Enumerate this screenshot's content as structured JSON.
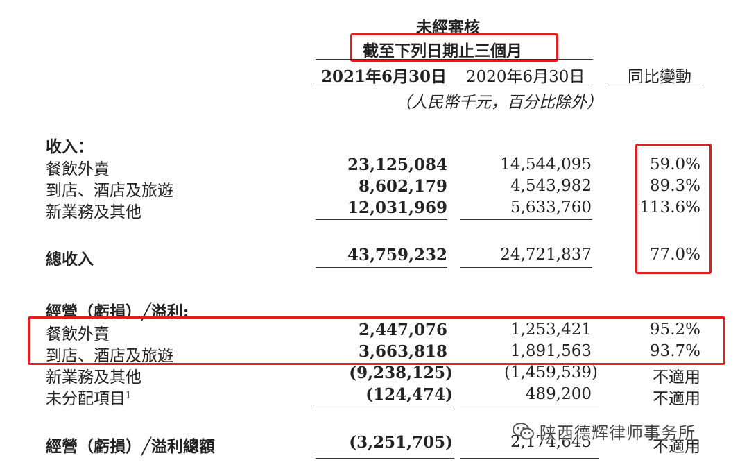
{
  "header": {
    "unaudited": "未經審核",
    "period": "截至下列日期止三個月",
    "col_2021": "2021年6月30日",
    "col_2020": "2020年6月30日",
    "col_yoy": "同比變動",
    "unit_note": "（人民幣千元，百分比除外）"
  },
  "revenue": {
    "title": "收入：",
    "rows": [
      {
        "label": "餐飲外賣",
        "v2021": "23,125,084",
        "v2020": "14,544,095",
        "yoy": "59.0%"
      },
      {
        "label": "到店、酒店及旅遊",
        "v2021": "8,602,179",
        "v2020": "4,543,982",
        "yoy": "89.3%"
      },
      {
        "label": "新業務及其他",
        "v2021": "12,031,969",
        "v2020": "5,633,760",
        "yoy": "113.6%"
      }
    ],
    "total": {
      "label": "總收入",
      "v2021": "43,759,232",
      "v2020": "24,721,837",
      "yoy": "77.0%"
    }
  },
  "operating": {
    "title": "經營（虧損）╱溢利:",
    "rows": [
      {
        "label": "餐飲外賣",
        "v2021": "2,447,076",
        "v2020": "1,253,421",
        "yoy": "95.2%"
      },
      {
        "label": "到店、酒店及旅遊",
        "v2021": "3,663,818",
        "v2020": "1,891,563",
        "yoy": "93.7%"
      },
      {
        "label": "新業務及其他",
        "v2021": "(9,238,125)",
        "v2020": "(1,459,539)",
        "yoy": "不適用"
      },
      {
        "label": "未分配項目",
        "footnote": "1",
        "v2021": "(124,474)",
        "v2020": "489,200",
        "yoy": "不適用"
      }
    ],
    "total": {
      "label": "經營（虧損）╱溢利總額",
      "v2021": "(3,251,705)",
      "v2020": "2,174,645",
      "yoy": "不適用"
    }
  },
  "watermark": {
    "text": "陕西德辉律师事务所",
    "icon": "wechat-icon"
  },
  "colors": {
    "highlight": "#e02020",
    "text": "#222222"
  }
}
